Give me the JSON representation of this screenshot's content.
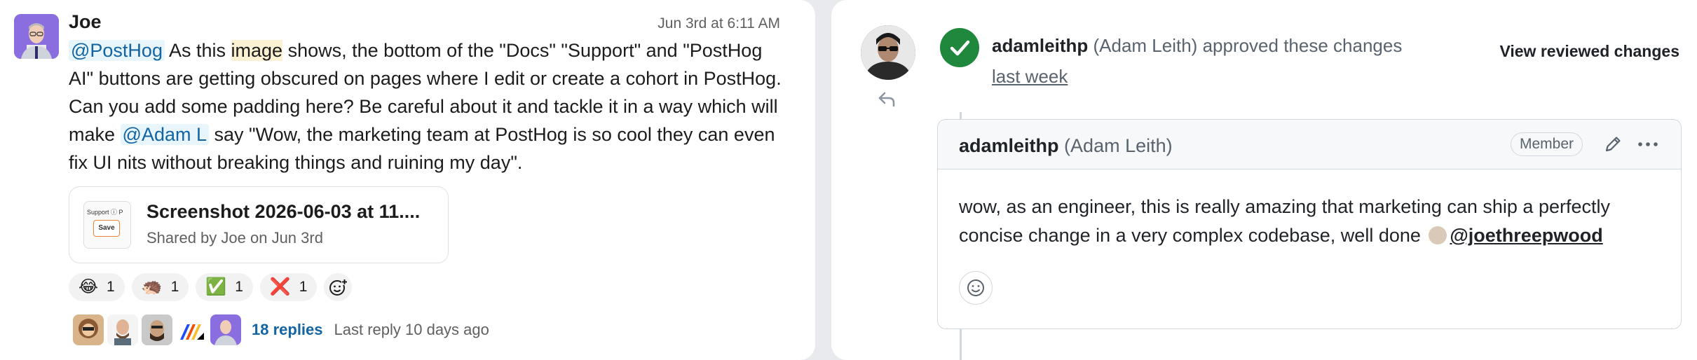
{
  "slack": {
    "author": "Joe",
    "timestamp": "Jun 3rd at 6:11 AM",
    "message": {
      "mention1": "@PostHog",
      "t1": " As this ",
      "highlight": "image",
      "t2": " shows, the bottom of the \"Docs\" \"Support\" and \"PostHog AI\" buttons are getting obscured on pages where I edit or create a cohort in PostHog. Can you add some padding here? Be careful about it and tackle it in a way which will make ",
      "mention2": "@Adam L",
      "t3": " say \"Wow, the marketing team at PostHog is so cool they can even fix UI nits without breaking things and ruining my day\"."
    },
    "attachment": {
      "name": "Screenshot 2026-06-03 at 11....",
      "subtitle": "Shared by Joe on Jun 3rd",
      "thumb_top": "Support ⓘ   P",
      "thumb_button": "Save"
    },
    "reactions": [
      {
        "emoji": "😂",
        "icon": "joy-emoji",
        "count": "1"
      },
      {
        "emoji": "🦔",
        "icon": "hedgehog-emoji",
        "count": "1"
      },
      {
        "emoji": "✅",
        "icon": "check-mark-emoji",
        "count": "1"
      },
      {
        "emoji": "❌",
        "icon": "cross-mark-emoji",
        "count": "1"
      }
    ],
    "thread": {
      "replies": "18 replies",
      "last_reply": "Last reply 10 days ago"
    }
  },
  "github": {
    "reviewer_login": "adamleithp",
    "reviewer_name": "(Adam Leith)",
    "approved_text": "approved these changes",
    "time": "last week",
    "view_button": "View reviewed changes",
    "comment": {
      "author_login": "adamleithp",
      "author_name": "(Adam Leith)",
      "role_badge": "Member",
      "body": "wow, as an engineer, this is really amazing that marketing can ship a perfectly concise change in a very complex codebase, well done",
      "mention": "@joethreepwood"
    },
    "colors": {
      "approve_green": "#1f883d",
      "slack_link": "#1264a3",
      "border": "#d0d7de"
    }
  }
}
